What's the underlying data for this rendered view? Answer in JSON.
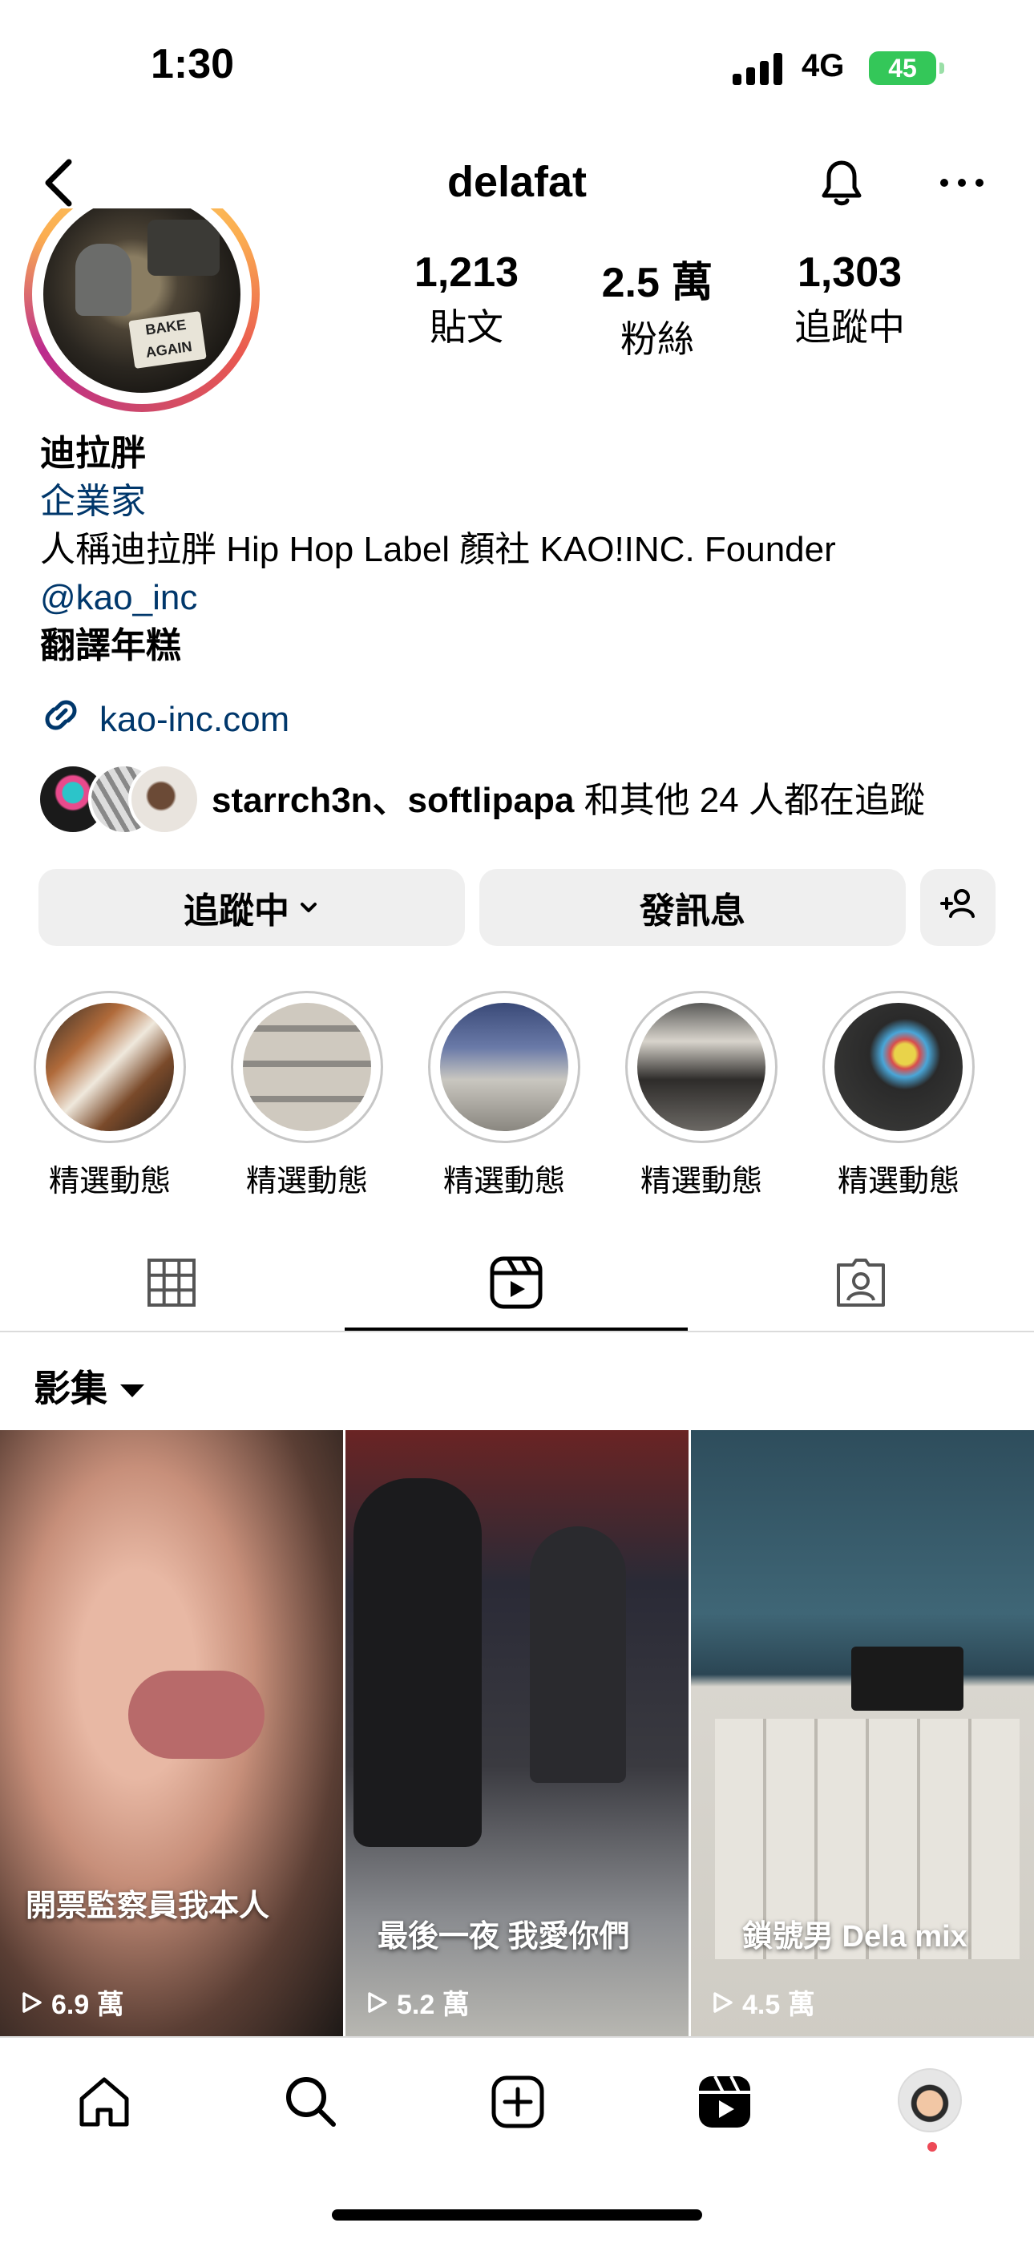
{
  "status_bar": {
    "time": "1:30",
    "network": "4G",
    "battery": "45"
  },
  "header": {
    "username": "delafat"
  },
  "stats": [
    {
      "value": "1,213",
      "label": "貼文"
    },
    {
      "value": "2.5 萬",
      "label": "粉絲"
    },
    {
      "value": "1,303",
      "label": "追蹤中"
    }
  ],
  "bio": {
    "name": "迪拉胖",
    "category": "企業家",
    "description": "人稱迪拉胖 Hip Hop Label 顏社 KAO!INC. Founder",
    "mention": "@kao_inc",
    "extra": "翻譯年糕",
    "link": "kao-inc.com",
    "avatar_badge": "BAKE AGAIN"
  },
  "followed_by": {
    "names": "starrch3n、softlipapa",
    "suffix": " 和其他 24 人都在追蹤"
  },
  "buttons": {
    "following": "追蹤中",
    "message": "發訊息"
  },
  "highlights": [
    {
      "label": "精選動態"
    },
    {
      "label": "精選動態"
    },
    {
      "label": "精選動態"
    },
    {
      "label": "精選動態"
    },
    {
      "label": "精選動態"
    }
  ],
  "collection": {
    "label": "影集"
  },
  "reels": [
    {
      "caption": "開票監察員我本人",
      "views": "6.9 萬"
    },
    {
      "caption": "最後一夜  我愛你們",
      "views": "5.2 萬"
    },
    {
      "caption": "鎖號男 Dela mix",
      "views": "4.5 萬"
    }
  ],
  "colors": {
    "link": "#00376b",
    "button_bg": "#efefef",
    "battery": "#34c759",
    "notification_dot": "#ed4956"
  }
}
